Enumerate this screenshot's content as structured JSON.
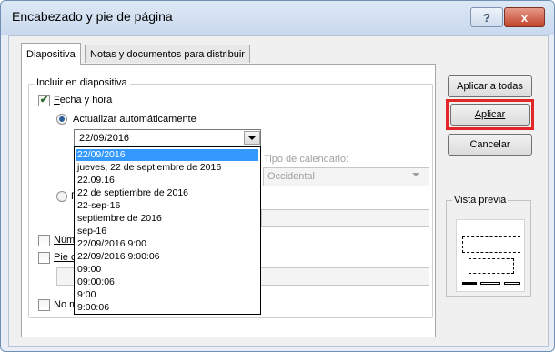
{
  "window": {
    "title": "Encabezado y pie de página",
    "help_icon": "?",
    "close_icon": "x"
  },
  "tabs": [
    {
      "label": "Diapositiva",
      "active": true
    },
    {
      "label": "Notas y documentos para distribuir",
      "active": false
    }
  ],
  "group": {
    "legend": "Incluir en diapositiva",
    "fecha": {
      "label": "Fecha y hora",
      "checked": true
    },
    "auto": {
      "label": "Actualizar automáticamente",
      "selected": true
    },
    "date_combo": {
      "value": "22/09/2016"
    },
    "dropdown_options": [
      "22/09/2016",
      "jueves, 22 de septiembre de 2016",
      "22.09.16",
      "22 de septiembre de 2016",
      "22-sep-16",
      "septiembre de 2016",
      "sep-16",
      "22/09/2016 9:00",
      "22/09/2016 9:00:06",
      "09:00",
      "09:00:06",
      "9:00",
      "9:00:06"
    ],
    "calendar": {
      "label": "Tipo de calendario:",
      "value": "Occidental"
    },
    "fijo_partial": "F",
    "numero_partial": "Núm",
    "pie_partial": "Pie c",
    "nomostrar_partial": "No m"
  },
  "buttons": {
    "apply_all": "Aplicar a todas",
    "apply": "Aplicar",
    "cancel": "Cancelar"
  },
  "preview": {
    "legend": "Vista previa"
  },
  "colors": {
    "selection": "#3399ff",
    "highlight_border": "#e32626",
    "close_button": "#c2442b"
  }
}
